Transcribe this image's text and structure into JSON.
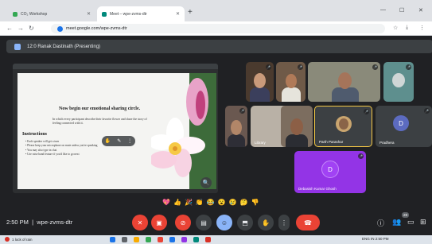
{
  "browser": {
    "tabs": [
      {
        "title": "CO₂ Workshop",
        "active": false,
        "favicon_color": "#34a853"
      },
      {
        "title": "Meet – wpe-zvms-dtr",
        "active": true,
        "favicon_color": "#00897b"
      }
    ],
    "new_tab": "+",
    "url": "meet.google.com/wpe-zvms-dtr"
  },
  "meet": {
    "presenting_label": "12:0 Ranak Dastinath (Presenting)",
    "meeting_time": "2:50 PM",
    "meeting_code": "wpe-zvms-dtr",
    "participant_count_badge": "28"
  },
  "slide": {
    "heading": "Now begin our emotional sharing circle.",
    "intro": "In which every participant describe their favorite flower and share the story of feeling connected with it.",
    "instructions_title": "Instructions",
    "instructions": [
      "Each speaker will get a turn",
      "Please keep your microphone on mute unless you're speaking",
      "You may also type in chat",
      "Use raise hand feature if you'd like to go next"
    ]
  },
  "participants": [
    {
      "name": "",
      "tile": "p1"
    },
    {
      "name": "",
      "tile": "p2"
    },
    {
      "name": "",
      "tile": "p3"
    },
    {
      "name": "",
      "tile": "p4"
    },
    {
      "name": "",
      "tile": "p5"
    },
    {
      "name": "Library",
      "tile": "p6"
    },
    {
      "name": "",
      "tile": "p7"
    },
    {
      "name": "Parth Parashar",
      "tile": "p8"
    },
    {
      "name": "Pradhera",
      "tile": "p9",
      "initial": "D"
    },
    {
      "name": "Debasish Kumar Ghosh",
      "tile": "p10",
      "initial": "D"
    }
  ],
  "reactions": [
    "💖",
    "👍",
    "🎉",
    "👏",
    "😂",
    "😮",
    "😢",
    "🤔",
    "👎"
  ],
  "colors": {
    "meet_bg": "#202124",
    "tile_bg": "#3c4043",
    "end_call": "#ea4335",
    "accent_blue": "#8ab4f8",
    "avatar_purple": "#9334e6"
  },
  "taskbar": {
    "left_text": "1 lock of rain",
    "right_text": "ENG IN  2:50 PM"
  }
}
